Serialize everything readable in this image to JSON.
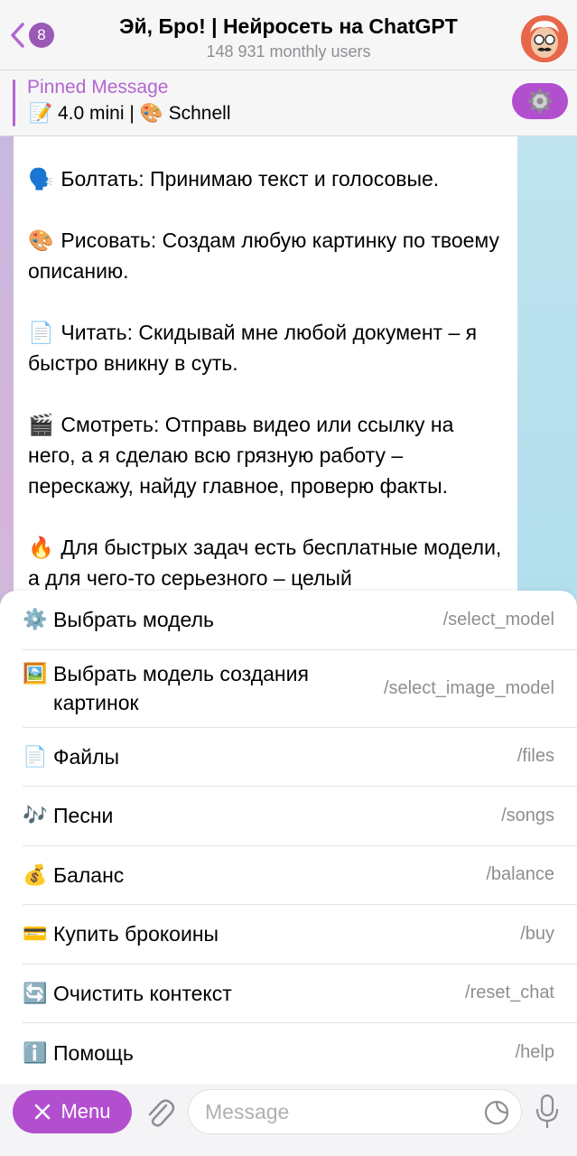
{
  "header": {
    "back_badge": "8",
    "title": "Эй, Бро! | Нейросеть на ChatGPT",
    "subtitle": "148 931 monthly users"
  },
  "pinned": {
    "label": "Pinned Message",
    "text": "📝 4.0 mini | 🎨 Schnell"
  },
  "message": {
    "paragraphs": [
      {
        "emoji": "🗣️",
        "text": "Болтать: Принимаю текст и голосовые."
      },
      {
        "emoji": "🎨",
        "text": "Рисовать: Создам любую картинку по твоему описанию."
      },
      {
        "emoji": "📄",
        "text": "Читать: Скидывай мне любой документ – я быстро вникну в суть."
      },
      {
        "emoji": "🎬",
        "text": "Смотреть: Отправь видео или ссылку на него, а я сделаю всю грязную работу – перескажу, найду главное, проверю факты."
      },
      {
        "emoji": "🔥",
        "text": "Для быстрых задач есть бесплатные модели, а для чего-то серьезного – целый"
      }
    ]
  },
  "commands": [
    {
      "icon": "⚙️",
      "label": "Выбрать модель",
      "command": "/select_model"
    },
    {
      "icon": "🖼️",
      "label": "Выбрать модель создания картинок",
      "command": "/select_image_model"
    },
    {
      "icon": "📄",
      "label": "Файлы",
      "command": "/files"
    },
    {
      "icon": "🎶",
      "label": "Песни",
      "command": "/songs"
    },
    {
      "icon": "💰",
      "label": "Баланс",
      "command": "/balance"
    },
    {
      "icon": "💳",
      "label": "Купить брокоины",
      "command": "/buy"
    },
    {
      "icon": "🔄",
      "label": "Очистить контекст",
      "command": "/reset_chat"
    },
    {
      "icon": "ℹ️",
      "label": "Помощь",
      "command": "/help"
    }
  ],
  "input": {
    "menu_label": "Menu",
    "placeholder": "Message"
  },
  "colors": {
    "accent": "#b24fcf",
    "pinned_accent": "#b565d0",
    "muted": "#8e8e93"
  },
  "icons": [
    "back-chevron-icon",
    "gear-icon",
    "close-icon",
    "paperclip-icon",
    "sticker-icon",
    "microphone-icon"
  ]
}
